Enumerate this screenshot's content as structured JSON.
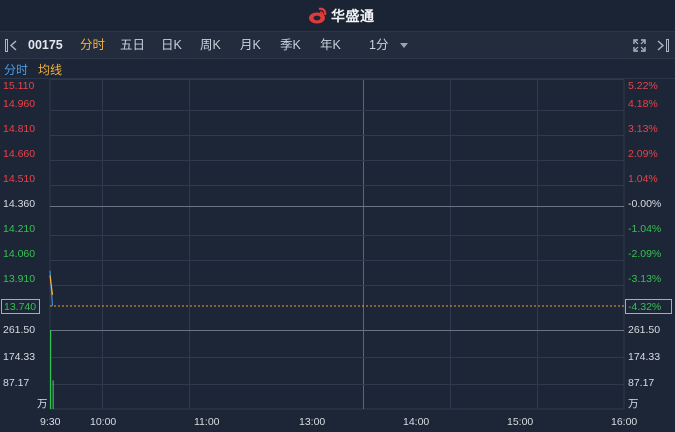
{
  "app": {
    "brand": "华盛通"
  },
  "toolbar": {
    "stock_code": "00175",
    "tabs": [
      {
        "label": "分时",
        "active": true
      },
      {
        "label": "五日",
        "active": false
      },
      {
        "label": "日K",
        "active": false
      },
      {
        "label": "周K",
        "active": false
      },
      {
        "label": "月K",
        "active": false
      },
      {
        "label": "季K",
        "active": false
      },
      {
        "label": "年K",
        "active": false
      }
    ],
    "interval": "1分"
  },
  "indicators": {
    "time_share": "分时",
    "avg_line": "均线"
  },
  "price_axis": {
    "left": [
      "15.110",
      "14.960",
      "14.810",
      "14.660",
      "14.510",
      "14.360",
      "14.210",
      "14.060",
      "13.910"
    ],
    "right": [
      "5.22%",
      "4.18%",
      "3.13%",
      "2.09%",
      "1.04%",
      "-0.00%",
      "-1.04%",
      "-2.09%",
      "-3.13%"
    ],
    "current_price": "13.740",
    "current_pct": "-4.32%"
  },
  "volume_axis": {
    "left": [
      "261.50",
      "174.33",
      "87.17",
      "万"
    ],
    "right": [
      "261.50",
      "174.33",
      "87.17",
      "万"
    ]
  },
  "time_axis": [
    "9:30",
    "10:00",
    "11:00",
    "13:00",
    "14:00",
    "15:00",
    "16:00"
  ],
  "colors": {
    "up": "#e9424a",
    "down": "#33c24f",
    "neutral": "#d9dde3",
    "accent": "#f4b23e",
    "price_line": "#3f8fe0",
    "avg_line": "#f4b23e",
    "background": "#1d2636"
  },
  "chart_data": {
    "type": "line",
    "series": [
      {
        "name": "分时",
        "x": [
          "9:30",
          "9:31"
        ],
        "values": [
          13.96,
          13.74
        ]
      },
      {
        "name": "均线",
        "x": [
          "9:30",
          "9:31"
        ],
        "values": [
          13.93,
          13.81
        ]
      }
    ],
    "volume": {
      "x": [
        "9:30",
        "9:31"
      ],
      "values": [
        261.5,
        95
      ],
      "unit": "万"
    },
    "ylim": [
      13.74,
      15.11
    ],
    "prev_close": 14.36,
    "volume_max": 261.5
  }
}
